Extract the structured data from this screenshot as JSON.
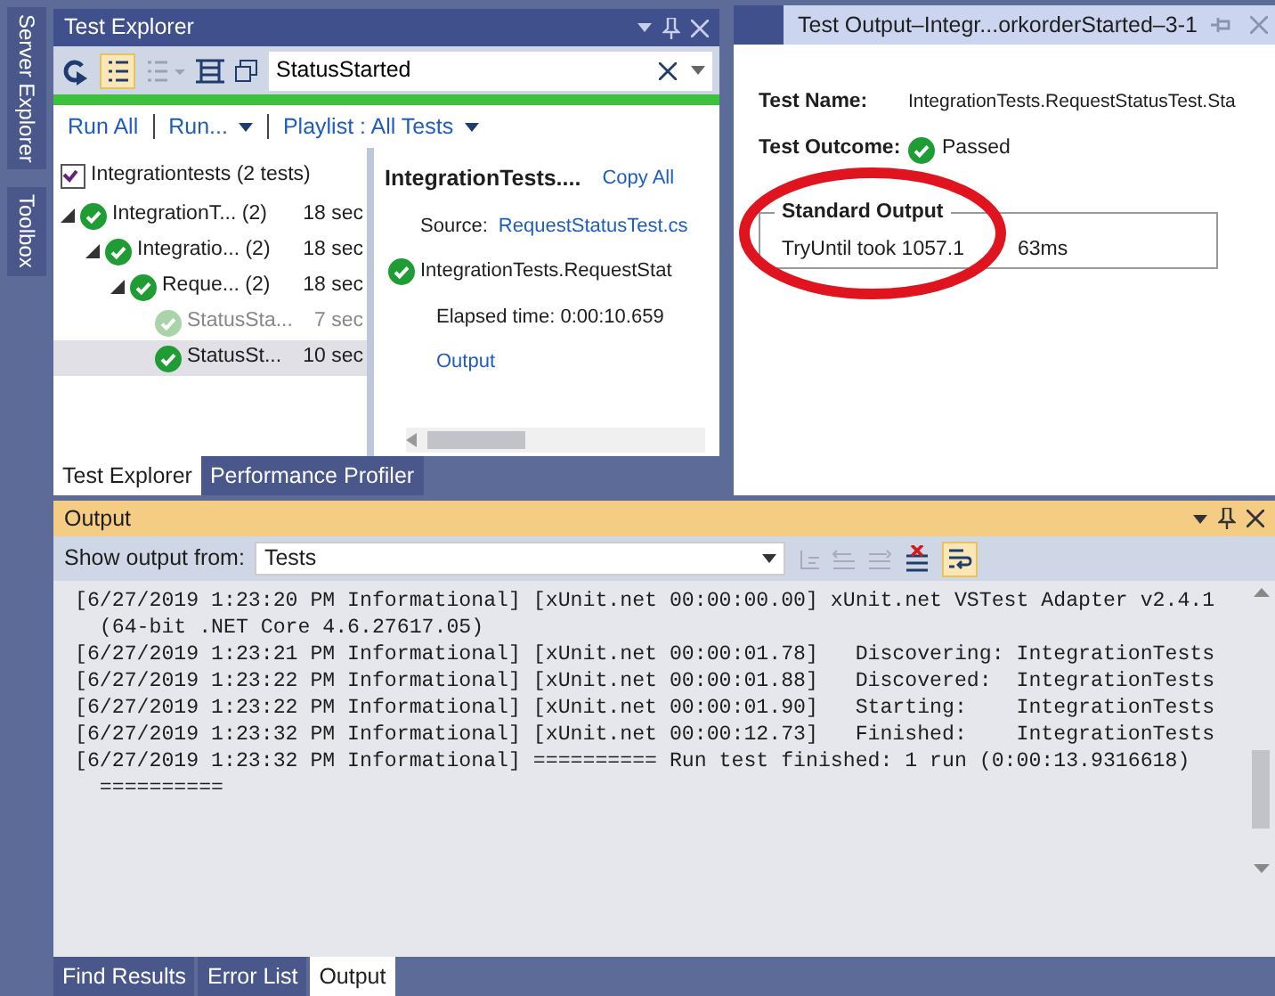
{
  "side_tabs": [
    "Server Explorer",
    "Toolbox"
  ],
  "test_explorer": {
    "title": "Test Explorer",
    "search": {
      "value": "StatusStarted"
    },
    "progress": {
      "level": 1
    },
    "actions": [
      {
        "label": "Run All",
        "dropdown": false
      },
      {
        "label": "Run...",
        "dropdown": true
      },
      {
        "label": "Playlist : All Tests",
        "dropdown": true
      }
    ],
    "tree": {
      "label": "Integrationtests (2 tests)",
      "children": [
        {
          "name": "IntegrationT...",
          "count": "(2)",
          "duration": "18 sec",
          "faded": false,
          "selected": false,
          "expanded": true,
          "children": [
            {
              "name": "Integratio...",
              "count": "(2)",
              "duration": "18 sec",
              "faded": false,
              "selected": false,
              "expanded": true,
              "children": [
                {
                  "name": "Reque...",
                  "count": "(2)",
                  "duration": "18 sec",
                  "faded": false,
                  "selected": false,
                  "expanded": true,
                  "children": [
                    {
                      "name": "StatusSta...",
                      "duration": "7 sec",
                      "faded": true,
                      "selected": false
                    },
                    {
                      "name": "StatusSt...",
                      "duration": "10 sec",
                      "faded": false,
                      "selected": true
                    }
                  ]
                }
              ]
            }
          ]
        }
      ]
    },
    "details": {
      "title": "IntegrationTests....",
      "copy": "Copy All",
      "source_label": "Source:",
      "source": "RequestStatusTest.cs",
      "test": "IntegrationTests.RequestStat",
      "elapsed": "Elapsed time: 0:00:10.659",
      "output_link": "Output"
    },
    "tabs": [
      {
        "label": "Test Explorer",
        "selected": true
      },
      {
        "label": "Performance Profiler",
        "selected": false
      }
    ]
  },
  "test_output": {
    "title": "Test Output–Integr...orkorderStarted–3-1",
    "name_label": "Test Name:",
    "name": "IntegrationTests.RequestStatusTest.Sta",
    "outcome_label": "Test Outcome:",
    "outcome": "Passed",
    "std_label": "Standard Output",
    "std_text": "TryUntil took 1057.1",
    "std_text_tail": "63ms"
  },
  "output": {
    "title": "Output",
    "show_label": "Show output from:",
    "source": "Tests",
    "lines": [
      "[6/27/2019 1:23:20 PM Informational] [xUnit.net 00:00:00.00] xUnit.net VSTest Adapter v2.4.1",
      "  (64-bit .NET Core 4.6.27617.05)",
      "[6/27/2019 1:23:21 PM Informational] [xUnit.net 00:00:01.78]   Discovering: IntegrationTests",
      "[6/27/2019 1:23:22 PM Informational] [xUnit.net 00:00:01.88]   Discovered:  IntegrationTests",
      "[6/27/2019 1:23:22 PM Informational] [xUnit.net 00:00:01.90]   Starting:    IntegrationTests",
      "[6/27/2019 1:23:32 PM Informational] [xUnit.net 00:00:12.73]   Finished:    IntegrationTests",
      "[6/27/2019 1:23:32 PM Informational] ========== Run test finished: 1 run (0:00:13.9316618)",
      "  =========="
    ]
  },
  "bottom_tabs": [
    {
      "label": "Find Results",
      "selected": false
    },
    {
      "label": "Error List",
      "selected": false
    },
    {
      "label": "Output",
      "selected": true
    }
  ]
}
